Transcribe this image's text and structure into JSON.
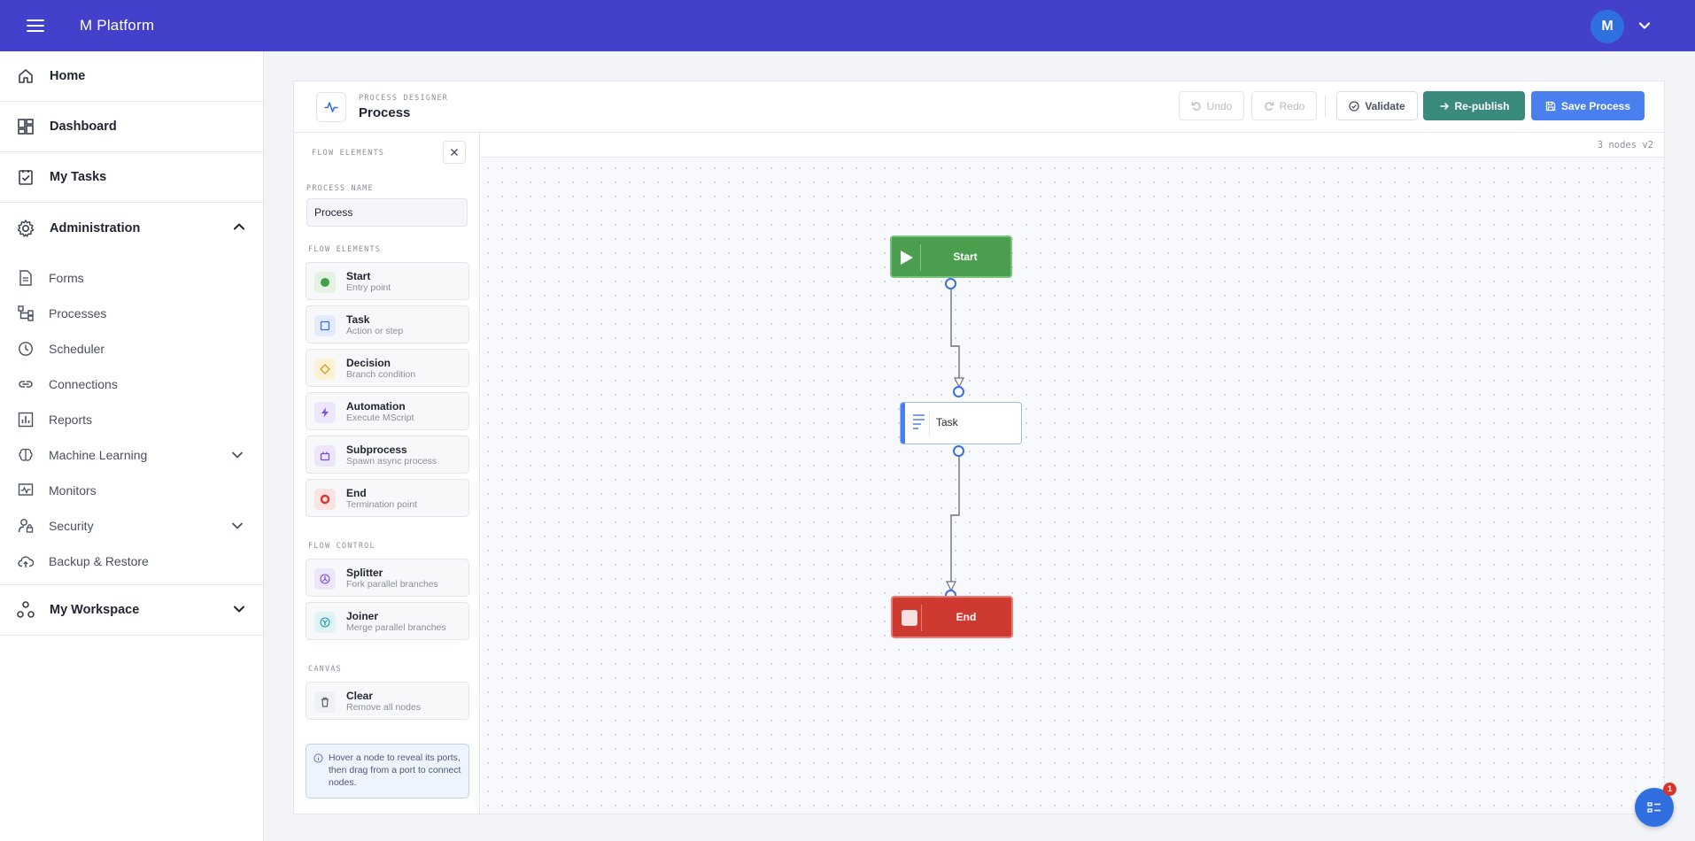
{
  "app": {
    "title": "M Platform",
    "user_initial": "M"
  },
  "sidebar": {
    "home": "Home",
    "dashboard": "Dashboard",
    "my_tasks": "My Tasks",
    "administration": "Administration",
    "admin_items": [
      "Forms",
      "Processes",
      "Scheduler",
      "Connections",
      "Reports",
      "Machine Learning",
      "Monitors",
      "Security",
      "Backup & Restore"
    ],
    "my_workspace": "My Workspace"
  },
  "designer": {
    "eyebrow": "PROCESS DESIGNER",
    "title": "Process",
    "buttons": {
      "undo": "Undo",
      "redo": "Redo",
      "validate": "Validate",
      "republish": "Re-publish",
      "save": "Save Process"
    }
  },
  "palette": {
    "header": "FLOW ELEMENTS",
    "process_name_label": "PROCESS NAME",
    "process_name_value": "Process",
    "flow_elements_label": "FLOW ELEMENTS",
    "elements": [
      {
        "title": "Start",
        "sub": "Entry point"
      },
      {
        "title": "Task",
        "sub": "Action or step"
      },
      {
        "title": "Decision",
        "sub": "Branch condition"
      },
      {
        "title": "Automation",
        "sub": "Execute MScript"
      },
      {
        "title": "Subprocess",
        "sub": "Spawn async process"
      },
      {
        "title": "End",
        "sub": "Termination point"
      }
    ],
    "flow_control_label": "FLOW CONTROL",
    "control": [
      {
        "title": "Splitter",
        "sub": "Fork parallel branches"
      },
      {
        "title": "Joiner",
        "sub": "Merge parallel branches"
      }
    ],
    "canvas_label": "CANVAS",
    "canvas_items": [
      {
        "title": "Clear",
        "sub": "Remove all nodes"
      }
    ],
    "hint": "Hover a node to reveal its ports, then drag from a port to connect nodes."
  },
  "canvas": {
    "stats": "3 nodes v2",
    "nodes": {
      "start": "Start",
      "task": "Task",
      "end": "End"
    }
  },
  "colors": {
    "topbar": "#4340cc",
    "start": "#4a9e4e",
    "end": "#cf3a30",
    "accent": "#4a7ff0",
    "teal": "#3a8a7e"
  },
  "notifications": {
    "count": "1"
  }
}
